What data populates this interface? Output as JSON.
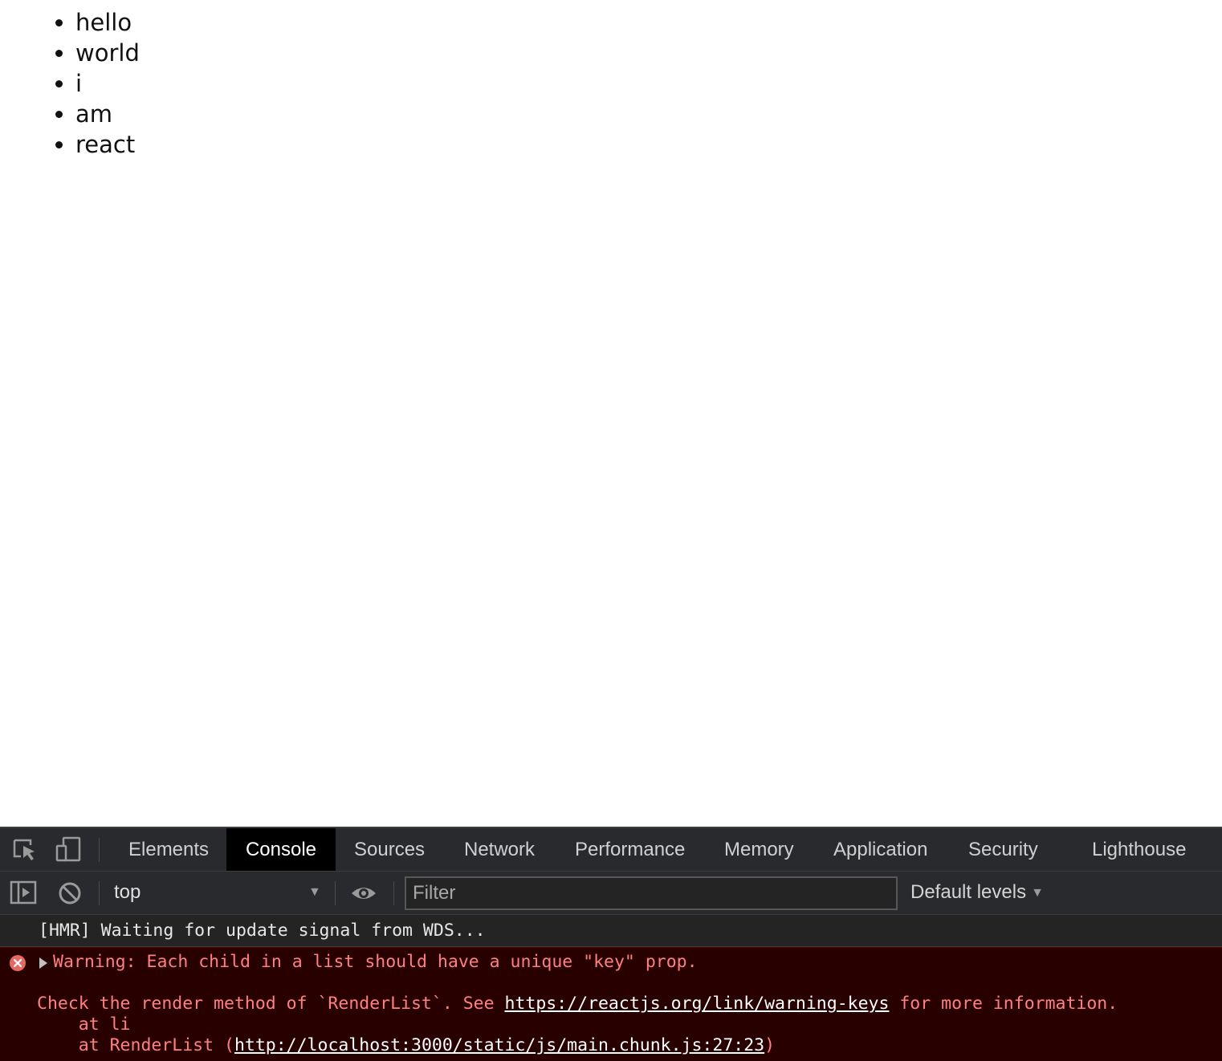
{
  "page": {
    "list_items": [
      "hello",
      "world",
      "i",
      "am",
      "react"
    ]
  },
  "devtools": {
    "toolbar_icons": [
      "inspect-element-icon",
      "device-toolbar-icon"
    ],
    "tabs": [
      {
        "label": "Elements",
        "active": false
      },
      {
        "label": "Console",
        "active": true
      },
      {
        "label": "Sources",
        "active": false
      },
      {
        "label": "Network",
        "active": false
      },
      {
        "label": "Performance",
        "active": false
      },
      {
        "label": "Memory",
        "active": false
      },
      {
        "label": "Application",
        "active": false
      },
      {
        "label": "Security",
        "active": false
      },
      {
        "label": "Lighthouse",
        "active": false
      }
    ],
    "console_toolbar": {
      "icons": [
        "sidebar-toggle-icon",
        "clear-console-icon",
        "live-expression-eye-icon"
      ],
      "context": "top",
      "filter_placeholder": "Filter",
      "filter_value": "",
      "levels": "Default levels"
    },
    "console_messages": {
      "log": "[HMR] Waiting for update signal from WDS...",
      "error": {
        "line1": "Warning: Each child in a list should have a unique \"key\" prop.",
        "line2_prefix": "Check the render method of `RenderList`. See ",
        "line2_link": "https://reactjs.org/link/warning-keys",
        "line2_suffix": " for more information.",
        "line3": "    at li",
        "line4_prefix": "    at RenderList (",
        "line4_link": "http://localhost:3000/static/js/main.chunk.js:27:23",
        "line4_suffix": ")"
      }
    },
    "colors": {
      "panel_bg": "#242424",
      "error_bg": "#290000",
      "error_text": "#ff8080",
      "error_icon": "#e46962",
      "active_tab_bg": "#000000"
    }
  }
}
